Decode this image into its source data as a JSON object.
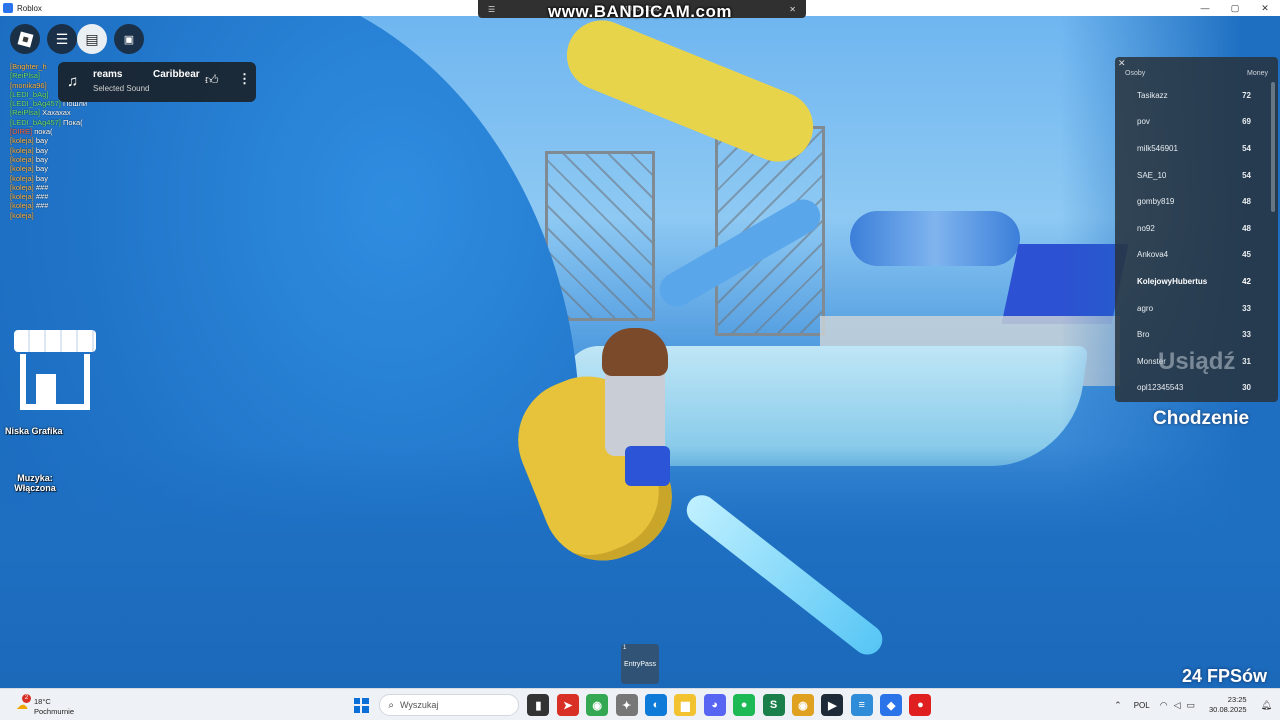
{
  "window": {
    "title": "Roblox",
    "controls": {
      "minimize": "—",
      "maximize": "▢",
      "close": "✕"
    }
  },
  "recorder": {
    "watermark": "www.BANDICAM.com",
    "resolution": "1920×1080"
  },
  "hud": {
    "sound": {
      "track_left": "reams",
      "track_right": "Caribbear",
      "subtitle": "Selected Sound"
    },
    "chat": [
      {
        "name": "[Brighter_h",
        "msg": "",
        "color": "orange"
      },
      {
        "name": "[ReiPlsa]",
        "msg": "",
        "color": "green"
      },
      {
        "name": "[monika96]",
        "msg": "",
        "color": "orange"
      },
      {
        "name": "[LEDI_bAg]",
        "msg": "",
        "color": "green"
      },
      {
        "name": "[LEDI_bAg457]",
        "msg": "Пошли",
        "color": "green"
      },
      {
        "name": "[ReiPlsa]",
        "msg": "Хахахах",
        "color": "green"
      },
      {
        "name": "[LEDI_bAg457]",
        "msg": "Пока(",
        "color": "green"
      },
      {
        "name": "[DIRE]",
        "msg": "пока(",
        "color": "red"
      },
      {
        "name": "[koleja]",
        "msg": "bay",
        "color": "orange"
      },
      {
        "name": "[koleja]",
        "msg": "bay",
        "color": "orange"
      },
      {
        "name": "[koleja]",
        "msg": "bay",
        "color": "orange"
      },
      {
        "name": "[koleja]",
        "msg": "bay",
        "color": "orange"
      },
      {
        "name": "[koleja]",
        "msg": "bay",
        "color": "orange"
      },
      {
        "name": "[koleja]",
        "msg": "###",
        "color": "orange"
      },
      {
        "name": "[koleja]",
        "msg": "###",
        "color": "orange"
      },
      {
        "name": "[koleja]",
        "msg": "###",
        "color": "orange"
      },
      {
        "name": "[koleja]",
        "msg": "",
        "color": "orange"
      }
    ],
    "shop_label": "Niska Grafika",
    "music_label": "Muzyka: Włączona",
    "sit_label": "Usiądź",
    "walk_label": "Chodzenie",
    "fps_label": "24 FPSów",
    "hotbar": {
      "slot_number": "1",
      "slot_label": "EntryPass"
    }
  },
  "leaderboard": {
    "header_left": "Osoby",
    "header_right": "Money",
    "close": "✕",
    "rows": [
      {
        "name": "Tasikazz",
        "value": "72"
      },
      {
        "name": "pov",
        "value": "69"
      },
      {
        "name": "milk546901",
        "value": "54"
      },
      {
        "name": "SAE_10",
        "value": "54"
      },
      {
        "name": "gomby819",
        "value": "48"
      },
      {
        "name": "no92",
        "value": "48"
      },
      {
        "name": "Ankova4",
        "value": "45"
      },
      {
        "name": "KolejowyHubertus",
        "value": "42"
      },
      {
        "name": "agro",
        "value": "33"
      },
      {
        "name": "Bro",
        "value": "33"
      },
      {
        "name": "Monster",
        "value": "31"
      },
      {
        "name": "opl12345543",
        "value": "30"
      }
    ]
  },
  "taskbar": {
    "weather": {
      "badge": "2",
      "temp": "18°C",
      "condition": "Pochmurnie"
    },
    "search_placeholder": "Wyszukaj",
    "apps": [
      {
        "name": "file-icon",
        "glyph": "▮",
        "color": "#333333"
      },
      {
        "name": "arrow-app-icon",
        "glyph": "➤",
        "color": "#d93025"
      },
      {
        "name": "chrome-icon",
        "glyph": "◉",
        "color": "#34a853"
      },
      {
        "name": "app-icon",
        "glyph": "✦",
        "color": "#777777"
      },
      {
        "name": "edge-icon",
        "glyph": "◐",
        "color": "#0f7bd8"
      },
      {
        "name": "folder-icon",
        "glyph": "▆",
        "color": "#f2c230"
      },
      {
        "name": "discord-icon",
        "glyph": "◕",
        "color": "#5865f2"
      },
      {
        "name": "spotify-icon",
        "glyph": "●",
        "color": "#1db954"
      },
      {
        "name": "app2-icon",
        "glyph": "S",
        "color": "#1a7f4b"
      },
      {
        "name": "chrome2-icon",
        "glyph": "◉",
        "color": "#e0a020"
      },
      {
        "name": "terminal-icon",
        "glyph": "▶",
        "color": "#1e2a38"
      },
      {
        "name": "notepad-icon",
        "glyph": "≡",
        "color": "#2f8cd8"
      },
      {
        "name": "roblox-icon",
        "glyph": "◆",
        "color": "#2a73e8"
      },
      {
        "name": "record-icon",
        "glyph": "●",
        "color": "#e02020"
      }
    ],
    "tray": {
      "language": "POL",
      "time": "23:25",
      "date": "30.08.2025"
    }
  }
}
